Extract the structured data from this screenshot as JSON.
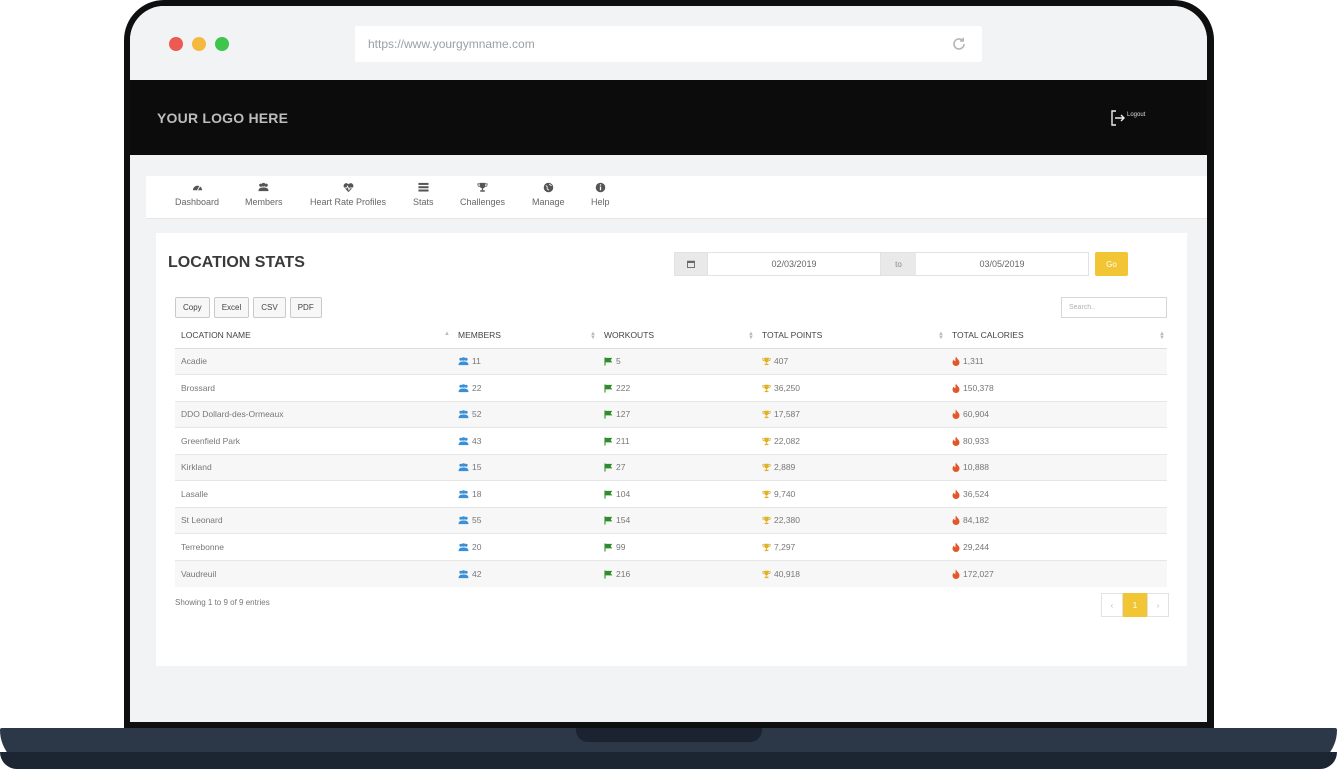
{
  "browser": {
    "url": "https://www.yourgymname.com"
  },
  "header": {
    "logo_text": "YOUR LOGO HERE",
    "logout_label": "Logout"
  },
  "nav": {
    "items": [
      {
        "label": "Dashboard",
        "icon": "dashboard-icon"
      },
      {
        "label": "Members",
        "icon": "members-icon"
      },
      {
        "label": "Heart Rate Profiles",
        "icon": "heart-rate-icon"
      },
      {
        "label": "Stats",
        "icon": "stats-icon"
      },
      {
        "label": "Challenges",
        "icon": "trophy-icon"
      },
      {
        "label": "Manage",
        "icon": "globe-icon"
      },
      {
        "label": "Help",
        "icon": "info-icon"
      }
    ]
  },
  "page": {
    "title": "LOCATION STATS"
  },
  "daterange": {
    "from": "02/03/2019",
    "to_label": "to",
    "to": "03/05/2019",
    "go_label": "Go"
  },
  "export": {
    "copy": "Copy",
    "excel": "Excel",
    "csv": "CSV",
    "pdf": "PDF"
  },
  "search": {
    "placeholder": "Search.."
  },
  "table": {
    "headers": [
      "LOCATION NAME",
      "MEMBERS",
      "WORKOUTS",
      "TOTAL POINTS",
      "TOTAL CALORIES"
    ],
    "rows": [
      {
        "name": "Acadie",
        "members": "11",
        "workouts": "5",
        "points": "407",
        "calories": "1,311"
      },
      {
        "name": "Brossard",
        "members": "22",
        "workouts": "222",
        "points": "36,250",
        "calories": "150,378"
      },
      {
        "name": "DDO Dollard-des-Ormeaux",
        "members": "52",
        "workouts": "127",
        "points": "17,587",
        "calories": "60,904"
      },
      {
        "name": "Greenfield Park",
        "members": "43",
        "workouts": "211",
        "points": "22,082",
        "calories": "80,933"
      },
      {
        "name": "Kirkland",
        "members": "15",
        "workouts": "27",
        "points": "2,889",
        "calories": "10,888"
      },
      {
        "name": "Lasalle",
        "members": "18",
        "workouts": "104",
        "points": "9,740",
        "calories": "36,524"
      },
      {
        "name": "St Leonard",
        "members": "55",
        "workouts": "154",
        "points": "22,380",
        "calories": "84,182"
      },
      {
        "name": "Terrebonne",
        "members": "20",
        "workouts": "99",
        "points": "7,297",
        "calories": "29,244"
      },
      {
        "name": "Vaudreuil",
        "members": "42",
        "workouts": "216",
        "points": "40,918",
        "calories": "172,027"
      }
    ]
  },
  "footer": {
    "entries_text": "Showing 1 to 9 of 9 entries",
    "prev": "‹",
    "current_page": "1",
    "next": "›"
  },
  "colors": {
    "accent": "#f2c534",
    "members_icon": "#3a8fd6",
    "workouts_icon": "#2e8b2e",
    "points_icon": "#e0b12a",
    "calories_icon": "#e2562a"
  }
}
